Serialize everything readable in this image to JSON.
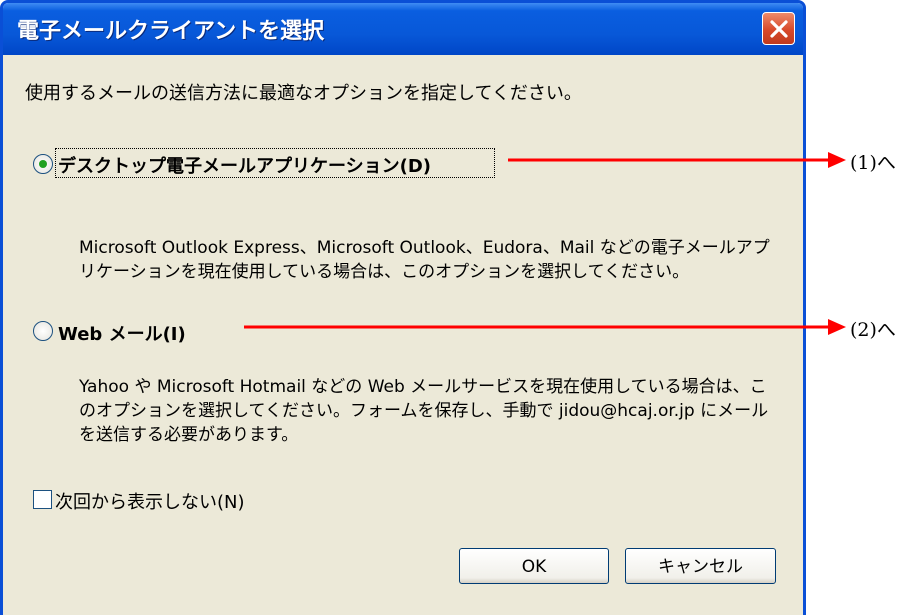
{
  "dialog": {
    "title": "電子メールクライアントを選択",
    "intro": "使用するメールの送信方法に最適なオプションを指定してください。",
    "options": [
      {
        "label": "デスクトップ電子メールアプリケーション(D)",
        "selected": true,
        "description": "Microsoft Outlook Express、Microsoft Outlook、Eudora、Mail などの電子メールアプリケーションを現在使用している場合は、このオプションを選択してください。"
      },
      {
        "label": "Web メール(I)",
        "selected": false,
        "description": "Yahoo や Microsoft Hotmail などの Web メールサービスを現在使用している場合は、このオプションを選択してください。フォームを保存し、手動で jidou@hcaj.or.jp にメールを送信する必要があります。"
      }
    ],
    "checkbox": {
      "label": "次回から表示しない(N)",
      "checked": false
    },
    "buttons": {
      "ok": "OK",
      "cancel": "キャンセル"
    }
  },
  "annotations": [
    {
      "text": "(1)へ"
    },
    {
      "text": "(2)へ"
    }
  ],
  "colors": {
    "title_bar": "#0858d8",
    "dialog_bg": "#ece9d8",
    "close_button": "#d8492a",
    "annotation_arrow": "#ff0000",
    "radio_selected": "#21a121"
  },
  "icons": {
    "close": "close-icon"
  }
}
